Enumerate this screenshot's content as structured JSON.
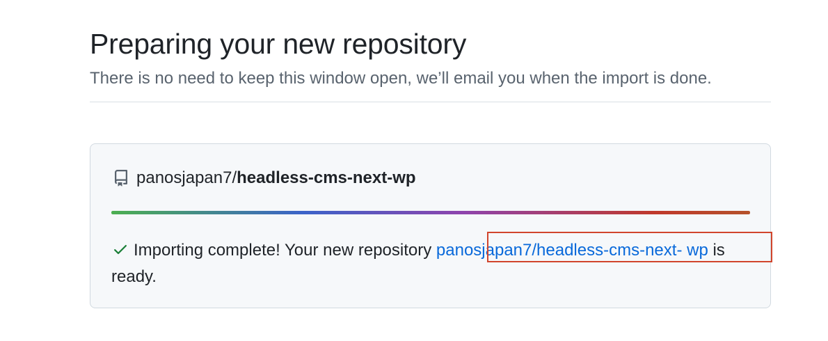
{
  "header": {
    "title": "Preparing your new repository",
    "subtitle": "There is no need to keep this window open, we’ll email you when the import is done."
  },
  "repo": {
    "owner": "panosjapan7",
    "separator": "/",
    "name": "headless-cms-next-wp",
    "icon": "repo-icon"
  },
  "progress": {
    "value": 1.0,
    "colors": [
      "#4caf50",
      "#3b63c9",
      "#8e44ad",
      "#c0392b",
      "#b5522b"
    ]
  },
  "status": {
    "icon": "check-icon",
    "icon_color": "#1a7f37",
    "prefix": "Importing complete! Your new repository ",
    "link_part1": "panosjapan7/headless-cms-next-",
    "link_part2": "wp",
    "suffix": " is ready.",
    "highlight_color": "#d1452c"
  }
}
